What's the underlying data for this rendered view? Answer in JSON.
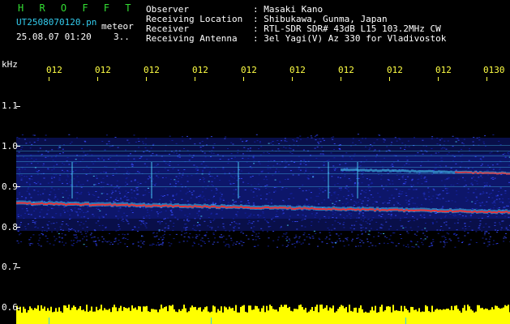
{
  "header": {
    "app_title": "H R O F F T",
    "file_name": "UT2508070120.pn",
    "file_type": "meteor",
    "datetime": "25.08.07 01:20",
    "page_indicator": "3..",
    "info": [
      {
        "label": "Observer",
        "value": ": Masaki Kano"
      },
      {
        "label": "Receiving Location",
        "value": ": Shibukawa, Gunma, Japan"
      },
      {
        "label": "Receiver",
        "value": ": RTL-SDR SDR# 43dB L15 103.2MHz CW"
      },
      {
        "label": "Receiving Antenna",
        "value": ": 3el Yagi(V) Az 330 for Vladivostok"
      }
    ]
  },
  "time_axis": {
    "ticks": [
      "012",
      "012",
      "012",
      "012",
      "012",
      "012",
      "012",
      "012",
      "012",
      "0130"
    ]
  },
  "freq_axis": {
    "unit": "kHz",
    "ticks": [
      "1.1",
      "1.0",
      "0.9",
      "0.8",
      "0.7",
      "0.6"
    ]
  },
  "colors": {
    "background": "#000000",
    "header_green": "#33dd33",
    "header_cyan": "#33ccee",
    "tick_yellow": "#ffff44",
    "axis_white": "#ffffff",
    "noise_blue": "#1a2ad0",
    "signal_red": "#ff2a2a",
    "signal_cyan": "#4dd8ff",
    "meter_yellow": "#ffff00"
  }
}
